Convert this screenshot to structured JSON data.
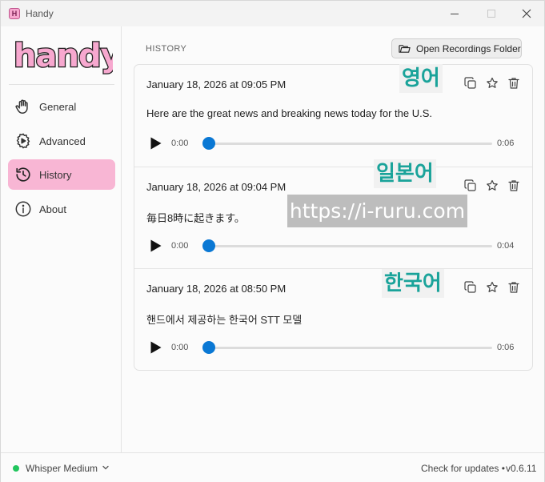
{
  "window": {
    "title": "Handy",
    "icon_letter": "H"
  },
  "brand": {
    "logo_text": "handy",
    "logo_fill": "#f7a8cf",
    "logo_stroke": "#1e1e1e"
  },
  "sidebar": {
    "items": [
      {
        "label": "General",
        "icon": "hand-icon",
        "active": false
      },
      {
        "label": "Advanced",
        "icon": "gear-icon",
        "active": false
      },
      {
        "label": "History",
        "icon": "history-icon",
        "active": true
      },
      {
        "label": "About",
        "icon": "info-icon",
        "active": false
      }
    ],
    "active_color": "#f8b6d4"
  },
  "main": {
    "section_title": "HISTORY",
    "open_folder_label": "Open Recordings Folder",
    "entries": [
      {
        "date": "January 18, 2026 at 09:05 PM",
        "text": "Here are the great news and breaking news today for the U.S.",
        "time_start": "0:00",
        "time_end": "0:06",
        "progress": 0
      },
      {
        "date": "January 18, 2026 at 09:04 PM",
        "text": "毎日8時に起きます。",
        "time_start": "0:00",
        "time_end": "0:04",
        "progress": 0
      },
      {
        "date": "January 18, 2026 at 08:50 PM",
        "text": "핸드에서 제공하는 한국어 STT 모델",
        "time_start": "0:00",
        "time_end": "0:06",
        "progress": 0
      }
    ],
    "accent": "#0a78d4"
  },
  "overlays": {
    "labels": [
      "영어",
      "일본어",
      "한국어"
    ],
    "label_color": "#1aa39a",
    "watermark": "https://i-ruru.com"
  },
  "footer": {
    "model": "Whisper Medium",
    "model_status_color": "#21c55d",
    "update_label": "Check for updates",
    "version": "v0.6.11",
    "separator": "•"
  }
}
